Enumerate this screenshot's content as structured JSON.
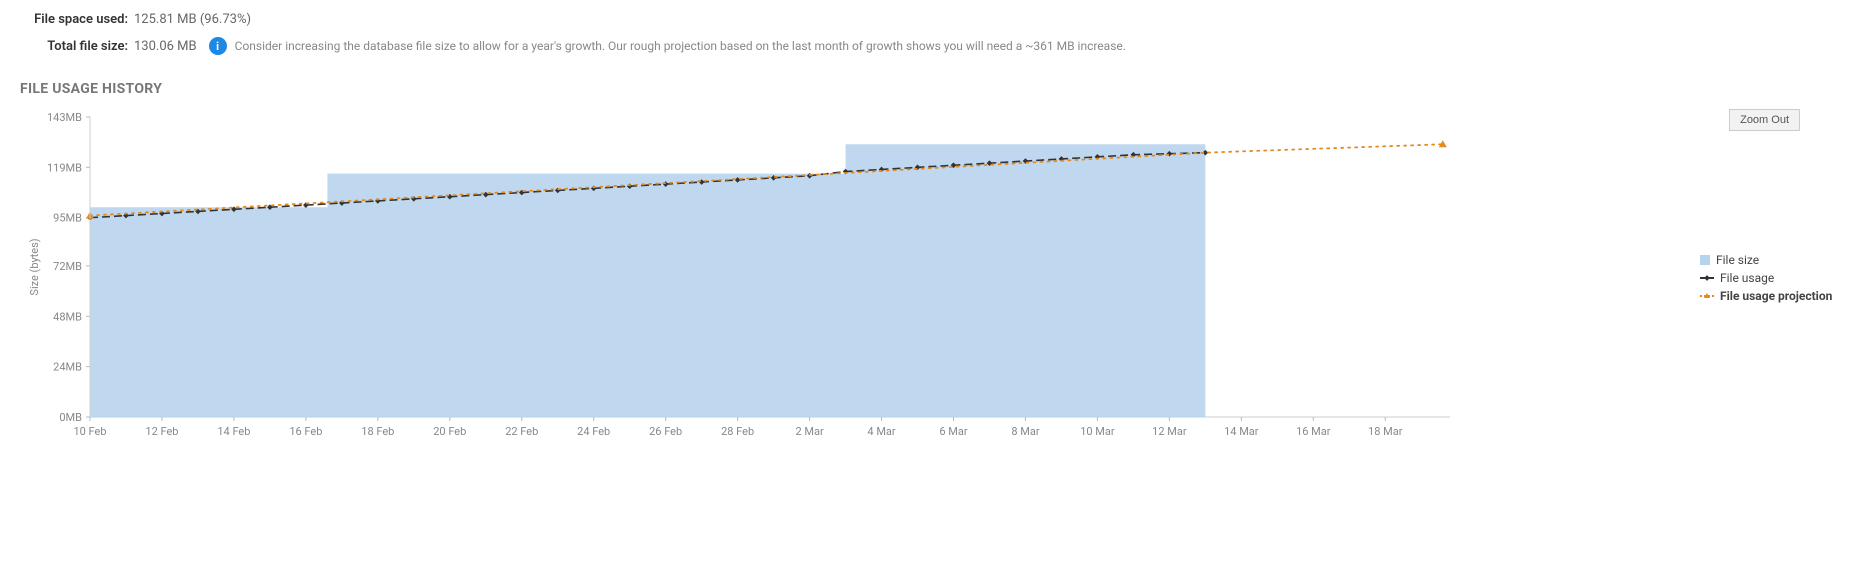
{
  "stats": {
    "file_space_used_label": "File space used:",
    "file_space_used_value": "125.81 MB (96.73%)",
    "total_file_size_label": "Total file size:",
    "total_file_size_value": "130.06 MB",
    "tip": "Consider increasing the database file size to allow for a year's growth. Our rough projection based on the last month of growth shows you will need a ~361 MB increase."
  },
  "section_title": "FILE USAGE HISTORY",
  "zoom_label": "Zoom Out",
  "legend": {
    "file_size": "File size",
    "file_usage": "File usage",
    "file_usage_projection": "File usage projection"
  },
  "chart_data": {
    "type": "area",
    "xlabel": "",
    "ylabel": "Size (bytes)",
    "ylim": [
      0,
      143
    ],
    "y_ticks": [
      0,
      24,
      48,
      72,
      95,
      119,
      143
    ],
    "y_tick_labels": [
      "0MB",
      "24MB",
      "48MB",
      "72MB",
      "95MB",
      "119MB",
      "143MB"
    ],
    "x_tick_labels": [
      "10 Feb",
      "12 Feb",
      "14 Feb",
      "16 Feb",
      "18 Feb",
      "20 Feb",
      "22 Feb",
      "24 Feb",
      "26 Feb",
      "28 Feb",
      "2 Mar",
      "4 Mar",
      "6 Mar",
      "8 Mar",
      "10 Mar",
      "12 Mar",
      "14 Mar",
      "16 Mar",
      "18 Mar"
    ],
    "series": [
      {
        "name": "File size",
        "kind": "step-area",
        "color": "#b8d4ed",
        "points": [
          {
            "x": 0,
            "y": 100
          },
          {
            "x": 3.3,
            "y": 100
          },
          {
            "x": 3.3,
            "y": 116
          },
          {
            "x": 10.5,
            "y": 116
          },
          {
            "x": 10.5,
            "y": 130
          },
          {
            "x": 15.5,
            "y": 130
          }
        ]
      },
      {
        "name": "File usage",
        "kind": "dashed-line",
        "color": "#333333",
        "points": [
          {
            "x": 0,
            "y": 95
          },
          {
            "x": 0.5,
            "y": 96
          },
          {
            "x": 1,
            "y": 97
          },
          {
            "x": 1.5,
            "y": 98
          },
          {
            "x": 2,
            "y": 99
          },
          {
            "x": 2.5,
            "y": 100
          },
          {
            "x": 3,
            "y": 101
          },
          {
            "x": 3.5,
            "y": 102
          },
          {
            "x": 4,
            "y": 103
          },
          {
            "x": 4.5,
            "y": 104
          },
          {
            "x": 5,
            "y": 105
          },
          {
            "x": 5.5,
            "y": 106
          },
          {
            "x": 6,
            "y": 107
          },
          {
            "x": 6.5,
            "y": 108
          },
          {
            "x": 7,
            "y": 109
          },
          {
            "x": 7.5,
            "y": 110
          },
          {
            "x": 8,
            "y": 111
          },
          {
            "x": 8.5,
            "y": 112
          },
          {
            "x": 9,
            "y": 113
          },
          {
            "x": 9.5,
            "y": 114
          },
          {
            "x": 10,
            "y": 115
          },
          {
            "x": 10.5,
            "y": 117
          },
          {
            "x": 11,
            "y": 118
          },
          {
            "x": 11.5,
            "y": 119
          },
          {
            "x": 12,
            "y": 120
          },
          {
            "x": 12.5,
            "y": 121
          },
          {
            "x": 13,
            "y": 122
          },
          {
            "x": 13.5,
            "y": 123
          },
          {
            "x": 14,
            "y": 124
          },
          {
            "x": 14.5,
            "y": 125
          },
          {
            "x": 15,
            "y": 125.5
          },
          {
            "x": 15.5,
            "y": 126
          }
        ]
      },
      {
        "name": "File usage projection",
        "kind": "dotted-line",
        "color": "#e38b1e",
        "points": [
          {
            "x": 0,
            "y": 96
          },
          {
            "x": 15.5,
            "y": 126
          },
          {
            "x": 18.8,
            "y": 130
          }
        ],
        "markers": [
          {
            "x": 0,
            "y": 96
          },
          {
            "x": 18.8,
            "y": 130
          }
        ]
      }
    ]
  }
}
